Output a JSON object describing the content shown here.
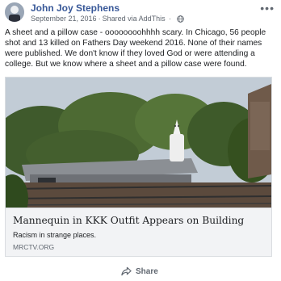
{
  "post": {
    "author": "John Joy Stephens",
    "date": "September 21, 2016",
    "via": "Shared via AddThis",
    "visibility_icon": "globe-icon",
    "menu_icon": "more-options-icon",
    "text": "A sheet and a pillow case - oooooooohhhh scary. In Chicago, 56 people shot and 13 killed on Fathers Day weekend 2016. None of their names were published. We don't know if they loved God or were attending a college. But we know where a sheet and a pillow case were found."
  },
  "link": {
    "title": "Mannequin in KKK Outfit Appears on Building",
    "description": "Racism in strange places.",
    "domain": "MRCTV.ORG"
  },
  "actions": {
    "share_label": "Share",
    "share_icon": "share-icon"
  }
}
